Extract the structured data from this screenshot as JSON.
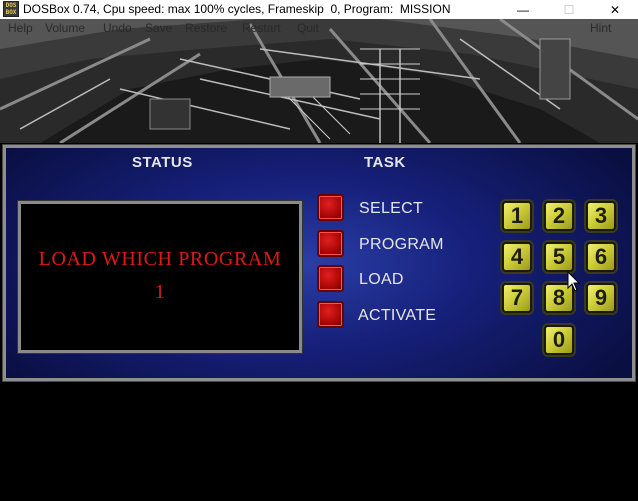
{
  "window": {
    "title": "DOSBox 0.74, Cpu speed: max 100% cycles, Frameskip  0, Program:  MISSION",
    "icon_text": "DOS BOX",
    "minimize_glyph": "—",
    "maximize_glyph": "☐",
    "close_glyph": "✕"
  },
  "menu": {
    "items": [
      "Help",
      "Volume",
      "Undo",
      "Save",
      "Restore",
      "Restart",
      "Quit"
    ],
    "right_item": "Hint"
  },
  "panel": {
    "status_heading": "STATUS",
    "task_heading": "TASK",
    "status_line1": "LOAD WHICH PROGRAM",
    "status_line2": "1",
    "tasks": [
      "SELECT",
      "PROGRAM",
      "LOAD",
      "ACTIVATE"
    ],
    "keypad": [
      "1",
      "2",
      "3",
      "4",
      "5",
      "6",
      "7",
      "8",
      "9",
      "0"
    ]
  },
  "colors": {
    "status_text": "#e01818",
    "panel_blue": "#16207a",
    "task_button_red": "#c01010",
    "keypad_yellow": "#d4d442"
  },
  "icons": {
    "cursor": "mouse-pointer-icon"
  }
}
